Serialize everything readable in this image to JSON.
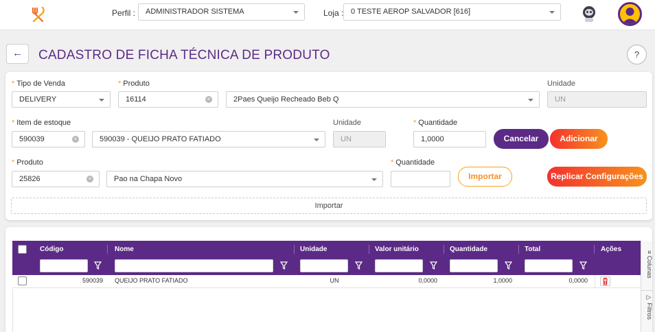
{
  "topbar": {
    "perfil_label": "Perfil :",
    "perfil_value": "ADMINISTRADOR SISTEMA",
    "loja_label": "Loja :",
    "loja_value": "0 TESTE AEROP SALVADOR [616]",
    "logo_icon": "fork-knife-icon",
    "astronaut_icon": "astronaut-icon",
    "avatar_icon": "user-avatar-icon"
  },
  "header": {
    "back_icon": "arrow-left-icon",
    "title": "CADASTRO DE FICHA TÉCNICA DE PRODUTO",
    "help_label": "?"
  },
  "form": {
    "tipo_venda_label": "Tipo de Venda",
    "tipo_venda_value": "DELIVERY",
    "produto_label": "Produto",
    "produto_code": "16114",
    "produto_name": "2Paes Queijo Recheado Beb Q",
    "unidade_label": "Unidade",
    "unidade_value": "UN",
    "item_estoque_label": "Item de estoque",
    "item_code": "590039",
    "item_name": "590039 - QUEIJO PRATO FATIADO",
    "item_unidade_label": "Unidade",
    "item_unidade_value": "UN",
    "quantidade_label": "Quantidade",
    "quantidade_value": "1,0000",
    "cancelar_label": "Cancelar",
    "adicionar_label": "Adicionar",
    "produto2_label": "Produto",
    "produto2_code": "25826",
    "produto2_name": "Pao na Chapa Novo",
    "quantidade2_label": "Quantidade",
    "quantidade2_value": "",
    "importar_label": "Importar",
    "replicar_label": "Replicar Configurações",
    "importar_area_label": "Importar"
  },
  "grid": {
    "headers": [
      "Código",
      "Nome",
      "Unidade",
      "Valor unitário",
      "Quantidade",
      "Total",
      "Ações"
    ],
    "rows": [
      {
        "codigo": "590039",
        "nome": "QUEIJO PRATO FATIADO",
        "unidade": "UN",
        "valor_unitario": "0,0000",
        "quantidade": "1,0000",
        "total": "0,0000"
      }
    ],
    "side_tabs": [
      "Colunas",
      "Filtros"
    ]
  },
  "colors": {
    "primary": "#5b2a86",
    "accent_start": "#f4312e",
    "accent_end": "#f7921e",
    "required": "#f0a020"
  }
}
